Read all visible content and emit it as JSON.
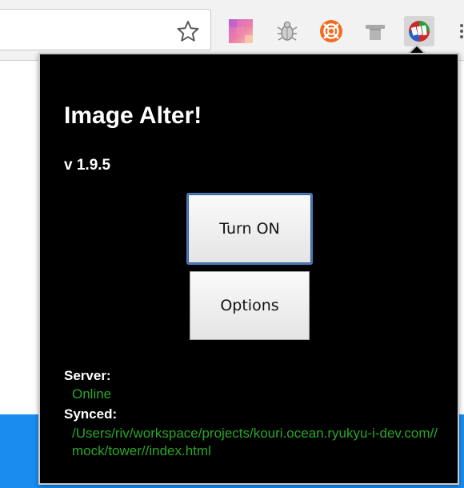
{
  "browser": {
    "extensions": [
      {
        "icon": "pixel-gradient-icon"
      },
      {
        "icon": "bug-icon"
      },
      {
        "icon": "lifebuoy-icon"
      },
      {
        "icon": "hat-icon"
      },
      {
        "icon": "image-alter-icon"
      }
    ]
  },
  "popup": {
    "title": "Image Alter!",
    "version": "v 1.9.5",
    "turn_on_label": "Turn ON",
    "options_label": "Options",
    "server_label": "Server:",
    "server_value": "Online",
    "synced_label": "Synced:",
    "synced_value": "/Users/riv/workspace/projects/kouri.ocean.ryukyu-i-dev.com//mock/tower//index.html"
  },
  "colors": {
    "popup_background": "#000000",
    "status_text": "#2aa52a",
    "page_accent": "#1a8cf0"
  }
}
